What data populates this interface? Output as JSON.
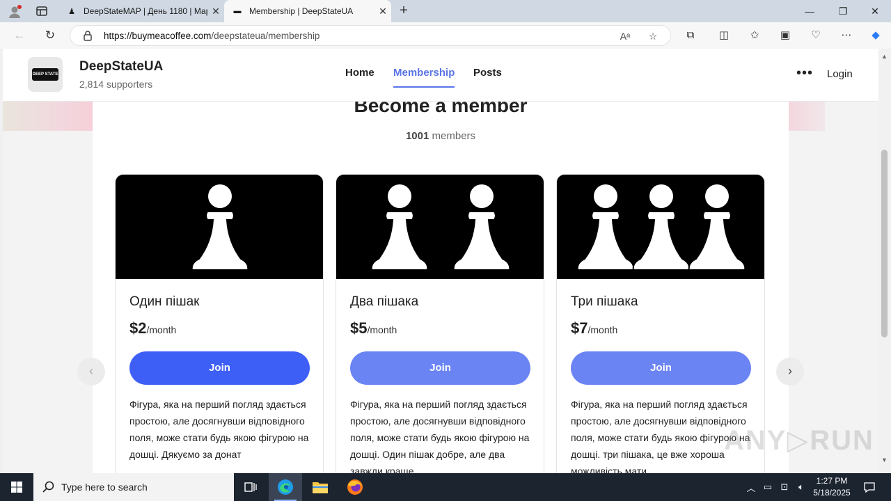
{
  "browser": {
    "tabs": [
      {
        "title": "DeepStateMAP | День 1180 | Мар",
        "active": false
      },
      {
        "title": "Membership | DeepStateUA",
        "active": true
      }
    ],
    "url_host": "https://buymeacoffee.com",
    "url_path": "/deepstateua/membership"
  },
  "site": {
    "name": "DeepStateUA",
    "supporters": "2,814 supporters",
    "logo_text": "DEEP STATE",
    "nav": [
      "Home",
      "Membership",
      "Posts"
    ],
    "login": "Login"
  },
  "membership": {
    "title": "Become a member",
    "count_number": "1001",
    "count_label": "members",
    "tiers": [
      {
        "name": "Один пішак",
        "price": "$2",
        "period": "/month",
        "pawns": 1,
        "join": "Join",
        "desc": "Фігура, яка на перший погляд здається простою, але досягнувши відповідного поля, може стати будь якою фігурою на дошці. Дякуємо за донат"
      },
      {
        "name": "Два пішака",
        "price": "$5",
        "period": "/month",
        "pawns": 2,
        "join": "Join",
        "desc": "Фігура, яка на перший погляд здається простою, але досягнувши відповідного поля, може стати будь якою фігурою на дошці. Один пішак добре, але два завжди краще"
      },
      {
        "name": "Три пішака",
        "price": "$7",
        "period": "/month",
        "pawns": 3,
        "join": "Join",
        "desc": "Фігура, яка на перший погляд здається простою, але досягнувши відповідного поля, може стати будь якою фігурою на дошці. три пішака, це вже хороша можливість мати"
      }
    ]
  },
  "taskbar": {
    "search_placeholder": "Type here to search",
    "time": "1:27 PM",
    "date": "5/18/2025"
  },
  "watermark": "ANY RUN",
  "colors": {
    "accent": "#5b74e8",
    "join_primary": "#3e5ff5",
    "join": "#6b84f4"
  }
}
